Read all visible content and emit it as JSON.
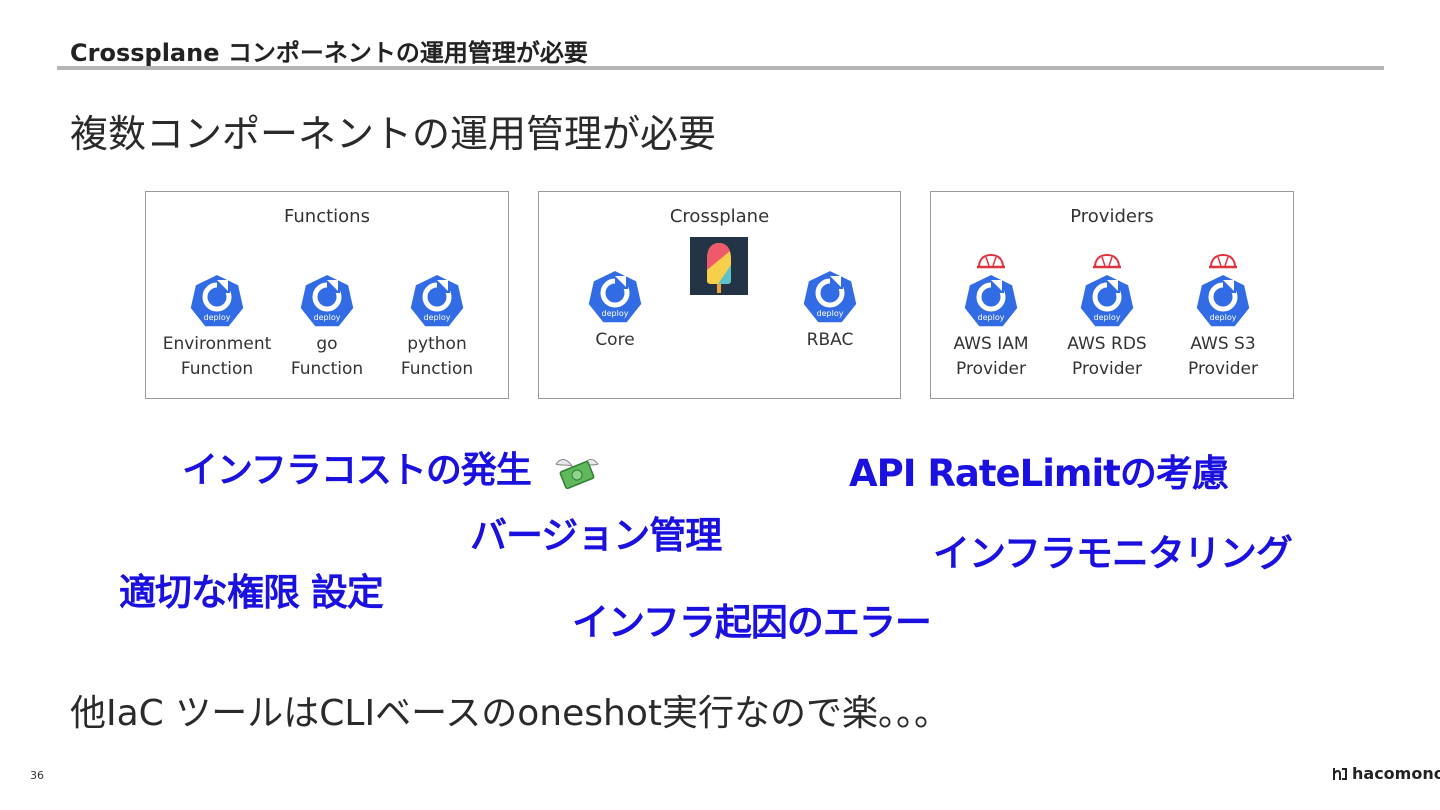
{
  "header": {
    "title": "Crossplane コンポーネントの運用管理が必要"
  },
  "subtitle": "複数コンポーネントの運用管理が必要",
  "groups": [
    {
      "title": "Functions",
      "items": [
        {
          "label": "Environment\nFunction",
          "icon": "deploy-icon"
        },
        {
          "label": "go\nFunction",
          "icon": "deploy-icon"
        },
        {
          "label": "python\nFunction",
          "icon": "deploy-icon"
        }
      ]
    },
    {
      "title": "Crossplane",
      "logo": "crossplane-logo",
      "items": [
        {
          "label": "Core",
          "icon": "deploy-icon"
        },
        {
          "label": "RBAC",
          "icon": "deploy-icon"
        }
      ]
    },
    {
      "title": "Providers",
      "items": [
        {
          "label": "AWS IAM\nProvider",
          "icon": "deploy-icon",
          "badge": "helmet-icon"
        },
        {
          "label": "AWS RDS\nProvider",
          "icon": "deploy-icon",
          "badge": "helmet-icon"
        },
        {
          "label": "AWS S3\nProvider",
          "icon": "deploy-icon",
          "badge": "helmet-icon"
        }
      ]
    }
  ],
  "deploy_icon_text": "deploy",
  "concerns": {
    "cost": "インフラコストの発生",
    "ratelimit": "API RateLimitの考慮",
    "version": "バージョン管理",
    "monitoring": "インフラモニタリング",
    "permission": "適切な権限 設定",
    "errors": "インフラ起因のエラー"
  },
  "closing": "他IaC ツールはCLIベースのoneshot実行なので楽。。。",
  "footer": {
    "page_number": "36",
    "logo_text": "hacomono"
  },
  "colors": {
    "accent": "#1a10e0",
    "k8s_blue": "#326ce5",
    "helmet_red": "#e0333f"
  }
}
